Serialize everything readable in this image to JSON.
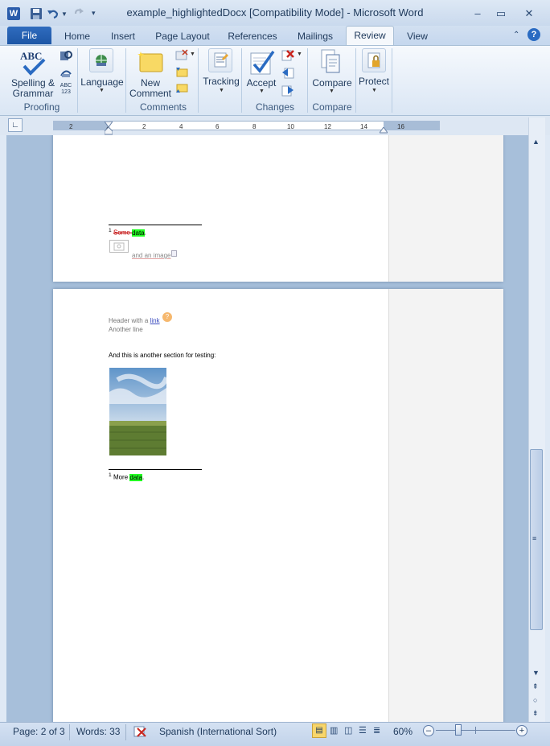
{
  "window": {
    "title": "example_highlightedDocx [Compatibility Mode]  -  Microsoft Word"
  },
  "colors": {
    "accent": "#2a6bc2",
    "highlight": "#22ff22",
    "ribbon_bg": "#e4ecf7"
  },
  "tabs": [
    "File",
    "Home",
    "Insert",
    "Page Layout",
    "References",
    "Mailings",
    "Review",
    "View"
  ],
  "ribbon": {
    "spelling_line1": "Spelling &",
    "spelling_line2": "Grammar",
    "language": "Language",
    "new_comment_line1": "New",
    "new_comment_line2": "Comment",
    "tracking": "Tracking",
    "accept": "Accept",
    "compare": "Compare",
    "protect": "Protect",
    "groups": {
      "proofing": "Proofing",
      "comments": "Comments",
      "changes": "Changes",
      "compare": "Compare"
    }
  },
  "ruler": {
    "ticks": [
      "2",
      "2",
      "2",
      "4",
      "6",
      "8",
      "10",
      "12",
      "14",
      "16"
    ]
  },
  "document": {
    "page1": {
      "footnote_mark": "1",
      "footnote_prefix": "Some ",
      "footnote_highlight": "data",
      "footnote_suffix": ".",
      "image_caption": "and an image"
    },
    "page2": {
      "header_prefix": "Header with a ",
      "header_link": "link",
      "header_line2": "Another line",
      "section_text": "And this is another section for testing:",
      "footnote_mark": "1",
      "footnote_prefix": "More ",
      "footnote_highlight": "data",
      "footnote_suffix": "."
    }
  },
  "status": {
    "page": "Page: 2 of 3",
    "words": "Words: 33",
    "language": "Spanish (International Sort)",
    "zoom": "60%"
  }
}
